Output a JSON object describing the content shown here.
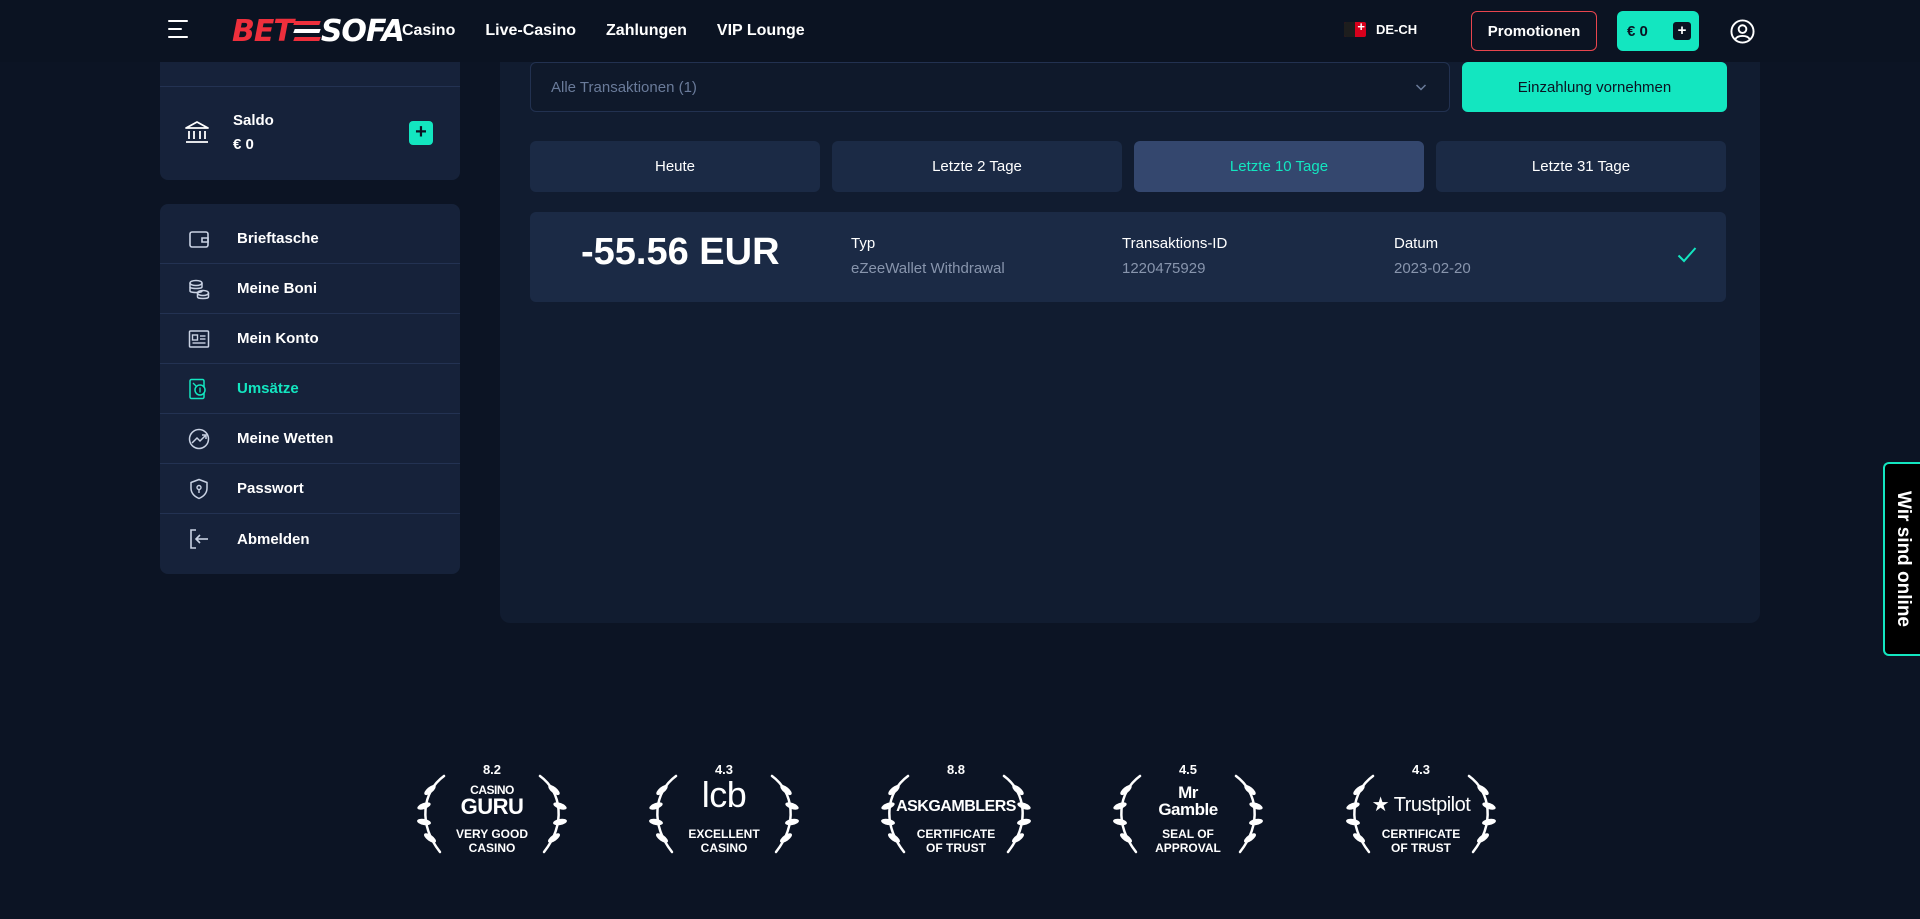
{
  "header": {
    "logo_left": "BET",
    "logo_right": "SOFA",
    "nav": [
      "Casino",
      "Live-Casino",
      "Zahlungen",
      "VIP Lounge"
    ],
    "language": "DE-CH",
    "promo_label": "Promotionen",
    "wallet_label": "€ 0",
    "wallet_plus": "+"
  },
  "sidebar": {
    "saldo_label": "Saldo",
    "saldo_value": "€ 0",
    "saldo_add": "+",
    "items": [
      {
        "label": "Brieftasche",
        "icon": "wallet-icon",
        "active": false
      },
      {
        "label": "Meine Boni",
        "icon": "coins-icon",
        "active": false
      },
      {
        "label": "Mein Konto",
        "icon": "id-card-icon",
        "active": false
      },
      {
        "label": "Umsätze",
        "icon": "transactions-icon",
        "active": true
      },
      {
        "label": "Meine Wetten",
        "icon": "bets-chart-icon",
        "active": false
      },
      {
        "label": "Passwort",
        "icon": "shield-lock-icon",
        "active": false
      },
      {
        "label": "Abmelden",
        "icon": "logout-icon",
        "active": false
      }
    ]
  },
  "main": {
    "filter_placeholder": "Alle Transaktionen (1)",
    "deposit_label": "Einzahlung vornehmen",
    "ranges": [
      {
        "label": "Heute",
        "active": false
      },
      {
        "label": "Letzte 2 Tage",
        "active": false
      },
      {
        "label": "Letzte 10 Tage",
        "active": true
      },
      {
        "label": "Letzte 31 Tage",
        "active": false
      }
    ],
    "transaction": {
      "amount": "-55.56 EUR",
      "type_label": "Typ",
      "type_value": "eZeeWallet Withdrawal",
      "id_label": "Transaktions-ID",
      "id_value": "1220475929",
      "date_label": "Datum",
      "date_value": "2023-02-20",
      "status_icon": "check-icon"
    }
  },
  "chat_label": "Wir sind online",
  "awards": [
    {
      "score": "8.2",
      "brand_top": "CASINO",
      "brand": "GURU",
      "caption1": "VERY GOOD",
      "caption2": "CASINO"
    },
    {
      "score": "4.3",
      "brand_top": "",
      "brand": "lcb",
      "caption1": "EXCELLENT",
      "caption2": "CASINO"
    },
    {
      "score": "8.8",
      "brand_top": "",
      "brand": "ASKGAMBLERS",
      "caption1": "CERTIFICATE",
      "caption2": "OF TRUST"
    },
    {
      "score": "4.5",
      "brand_top": "Mr",
      "brand": "Gamble",
      "caption1": "SEAL OF",
      "caption2": "APPROVAL"
    },
    {
      "score": "4.3",
      "brand_top": "",
      "brand": "★ Trustpilot",
      "caption1": "CERTIFICATE",
      "caption2": "OF TRUST"
    }
  ],
  "colors": {
    "accent": "#13e6c0",
    "brand_red": "#ee2f3c",
    "background": "#0c1424",
    "panel": "#16223a"
  }
}
